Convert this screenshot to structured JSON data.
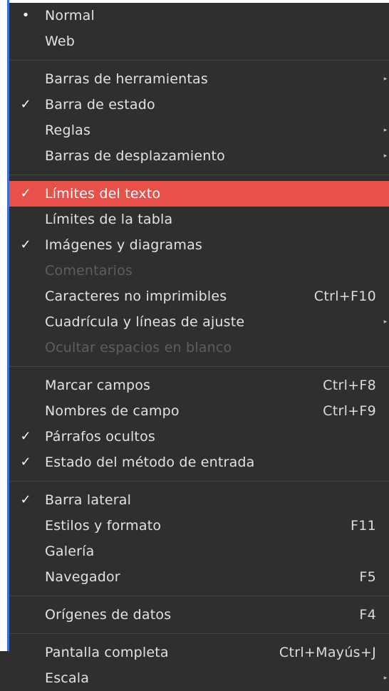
{
  "menu": {
    "top_label": "Límites del texto",
    "groups": [
      [
        {
          "label": "Normal",
          "mark": "•"
        },
        {
          "label": "Web"
        }
      ],
      [
        {
          "label": "Barras de herramientas",
          "submenu": true
        },
        {
          "label": "Barra de estado",
          "mark": "✓"
        },
        {
          "label": "Reglas",
          "submenu": true
        },
        {
          "label": "Barras de desplazamiento",
          "submenu": true
        }
      ],
      [
        {
          "label": "Límites del texto",
          "mark": "✓",
          "highlight": true
        },
        {
          "label": "Límites de la tabla"
        },
        {
          "label": "Imágenes y diagramas",
          "mark": "✓"
        },
        {
          "label": "Comentarios",
          "disabled": true
        },
        {
          "label": "Caracteres no imprimibles",
          "shortcut": "Ctrl+F10"
        },
        {
          "label": "Cuadrícula y líneas de ajuste",
          "submenu": true
        },
        {
          "label": "Ocultar espacios en blanco",
          "disabled": true
        }
      ],
      [
        {
          "label": "Marcar campos",
          "shortcut": "Ctrl+F8"
        },
        {
          "label": "Nombres de campo",
          "shortcut": "Ctrl+F9"
        },
        {
          "label": "Párrafos ocultos",
          "mark": "✓"
        },
        {
          "label": "Estado del método de entrada",
          "mark": "✓"
        }
      ],
      [
        {
          "label": "Barra lateral",
          "mark": "✓"
        },
        {
          "label": "Estilos y formato",
          "shortcut": "F11"
        },
        {
          "label": "Galería"
        },
        {
          "label": "Navegador",
          "shortcut": "F5"
        }
      ],
      [
        {
          "label": "Orígenes de datos",
          "shortcut": "F4"
        }
      ],
      [
        {
          "label": "Pantalla completa",
          "shortcut": "Ctrl+Mayús+J"
        },
        {
          "label": "Escala",
          "submenu": true
        }
      ]
    ]
  },
  "colors": {
    "menu_bg": "#2f2f2f",
    "highlight": "#e8504a",
    "text": "#e2e2e2",
    "disabled_text": "#5e5e5e",
    "separator": "#484848",
    "window_edge": "#3b6fd6"
  }
}
